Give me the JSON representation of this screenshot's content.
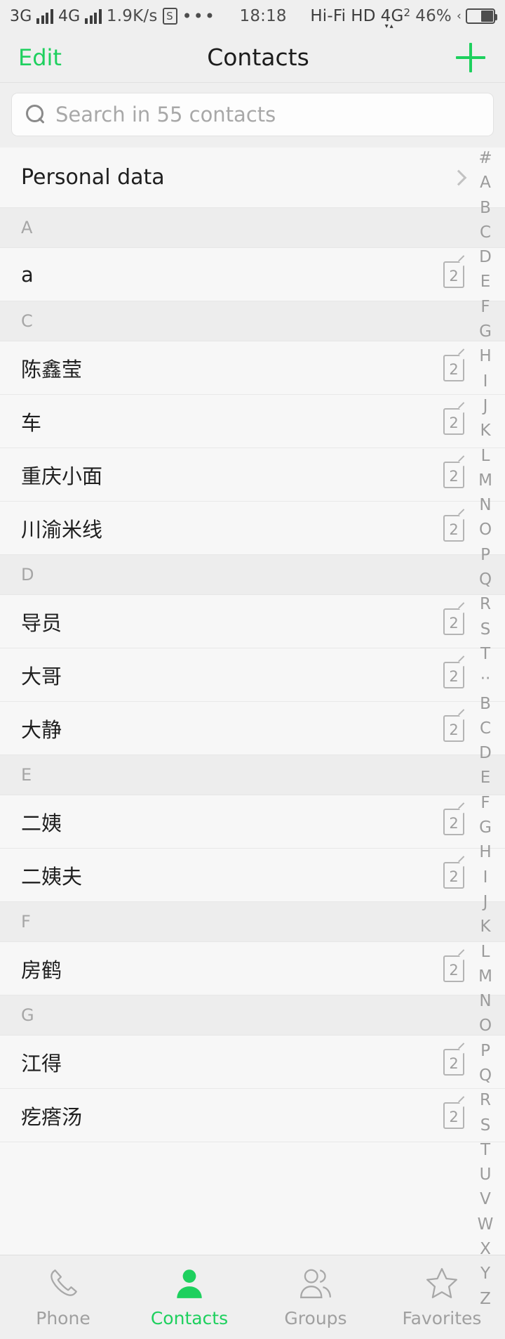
{
  "statusbar": {
    "net1": "3G",
    "net2": "4G",
    "speed": "1.9K/s",
    "s_badge": "S",
    "more": "•••",
    "time": "18:18",
    "hifi": "Hi-Fi",
    "hd": "HD",
    "g4_main": "4G",
    "g4_sup": "2",
    "battery_pct": "46%"
  },
  "nav": {
    "edit_label": "Edit",
    "title": "Contacts",
    "add_icon": "plus-icon"
  },
  "search": {
    "placeholder": "Search in 55 contacts",
    "icon": "search-icon",
    "contact_count": "55"
  },
  "list": {
    "personal_label": "Personal data",
    "sections": [
      {
        "letter": "A",
        "contacts": [
          {
            "name": "a",
            "badge": "2"
          }
        ]
      },
      {
        "letter": "C",
        "contacts": [
          {
            "name": "陈鑫莹",
            "badge": "2"
          },
          {
            "name": "车",
            "badge": "2"
          },
          {
            "name": "重庆小面",
            "badge": "2"
          },
          {
            "name": "川渝米线",
            "badge": "2"
          }
        ]
      },
      {
        "letter": "D",
        "contacts": [
          {
            "name": "导员",
            "badge": "2"
          },
          {
            "name": "大哥",
            "badge": "2"
          },
          {
            "name": "大静",
            "badge": "2"
          }
        ]
      },
      {
        "letter": "E",
        "contacts": [
          {
            "name": "二姨",
            "badge": "2"
          },
          {
            "name": "二姨夫",
            "badge": "2"
          }
        ]
      },
      {
        "letter": "F",
        "contacts": [
          {
            "name": "房鹤",
            "badge": "2"
          }
        ]
      },
      {
        "letter": "G",
        "contacts": [
          {
            "name": "江得",
            "badge": "2"
          },
          {
            "name": "疙瘩汤",
            "badge": "2"
          }
        ]
      }
    ]
  },
  "index_bar": {
    "letters": [
      "#",
      "A",
      "B",
      "C",
      "D",
      "E",
      "F",
      "G",
      "H",
      "I",
      "J",
      "K",
      "L",
      "M",
      "N",
      "O",
      "P",
      "Q",
      "R",
      "S",
      "T",
      "··",
      "B",
      "C",
      "D",
      "E",
      "F",
      "G",
      "H",
      "I",
      "J",
      "K",
      "L",
      "M",
      "N",
      "O",
      "P",
      "Q",
      "R",
      "S",
      "T",
      "U",
      "V",
      "W",
      "X",
      "Y",
      "Z"
    ]
  },
  "tabbar": {
    "tabs": [
      {
        "label": "Phone",
        "icon": "phone-icon",
        "active": false
      },
      {
        "label": "Contacts",
        "icon": "person-icon",
        "active": true
      },
      {
        "label": "Groups",
        "icon": "people-icon",
        "active": false
      },
      {
        "label": "Favorites",
        "icon": "star-icon",
        "active": false
      }
    ]
  },
  "colors": {
    "accent": "#1ed05e",
    "bg": "#f5f5f5",
    "row_bg": "#f7f7f7",
    "section_bg": "#ededed",
    "muted": "#a0a0a0"
  }
}
